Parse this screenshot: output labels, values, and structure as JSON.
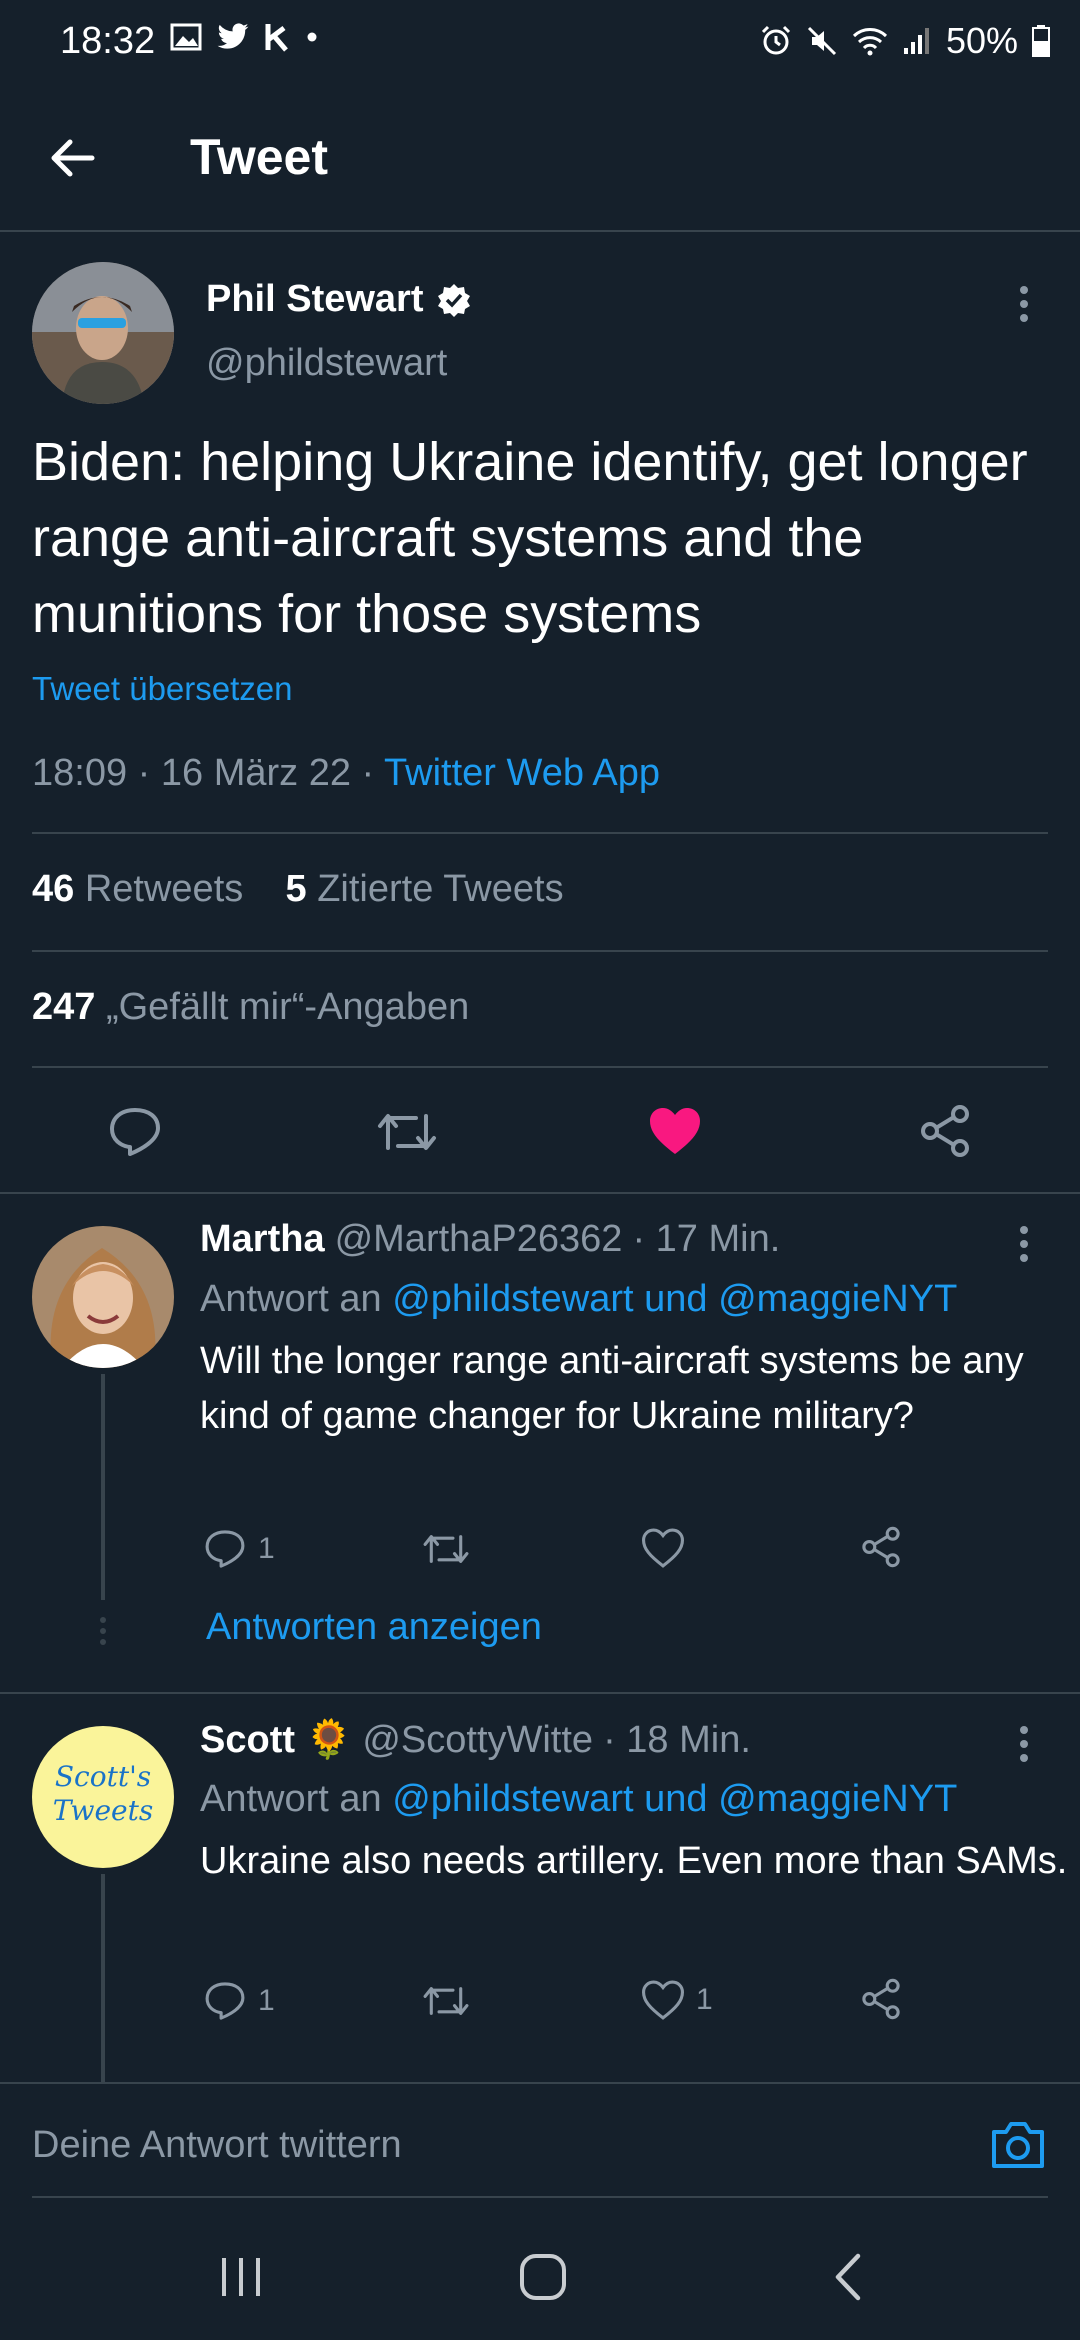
{
  "status_bar": {
    "time": "18:32",
    "battery": "50%"
  },
  "header": {
    "title": "Tweet"
  },
  "tweet": {
    "author_name": "Phil Stewart",
    "author_handle": "@phildstewart",
    "text": "Biden: helping Ukraine identify, get longer range anti-aircraft systems and the munitions for those systems",
    "translate_label": "Tweet übersetzen",
    "timestamp": "18:09 · 16 März 22 · ",
    "source": "Twitter Web App",
    "retweets_count": "46",
    "retweets_label": "Retweets",
    "quotes_count": "5",
    "quotes_label": "Zitierte Tweets",
    "likes_count": "247",
    "likes_label": "„Gefällt mir“-Angaben",
    "liked": true
  },
  "replies": [
    {
      "name": "Martha",
      "handle": "@MarthaP26362",
      "time": "· 17 Min.",
      "reply_prefix": "Antwort an ",
      "reply_targets": "@phildstewart und @maggieNYT",
      "text": "Will the longer range anti-aircraft systems be any kind of game changer for Ukraine military?",
      "reply_count": "1",
      "like_count": "",
      "show_replies_label": "Antworten anzeigen"
    },
    {
      "name": "Scott",
      "emoji": "🌻",
      "handle": "@ScottyWitte",
      "time": "· 18 Min.",
      "reply_prefix": "Antwort an ",
      "reply_targets": "@phildstewart und @maggieNYT",
      "text": "Ukraine also needs artillery. Even more than SAMs.",
      "reply_count": "1",
      "like_count": "1",
      "avatar_text": "Scott's Tweets"
    }
  ],
  "compose": {
    "placeholder": "Deine Antwort twittern"
  },
  "colors": {
    "background": "#15202b",
    "accent": "#1d9bf0",
    "like": "#f91880",
    "muted": "#8b98a5",
    "divider": "#38444d"
  },
  "icons": [
    "back-arrow-icon",
    "verified-badge-icon",
    "more-icon",
    "reply-icon",
    "retweet-icon",
    "like-icon",
    "share-icon",
    "camera-icon",
    "recents-icon",
    "home-icon",
    "nav-back-icon"
  ]
}
